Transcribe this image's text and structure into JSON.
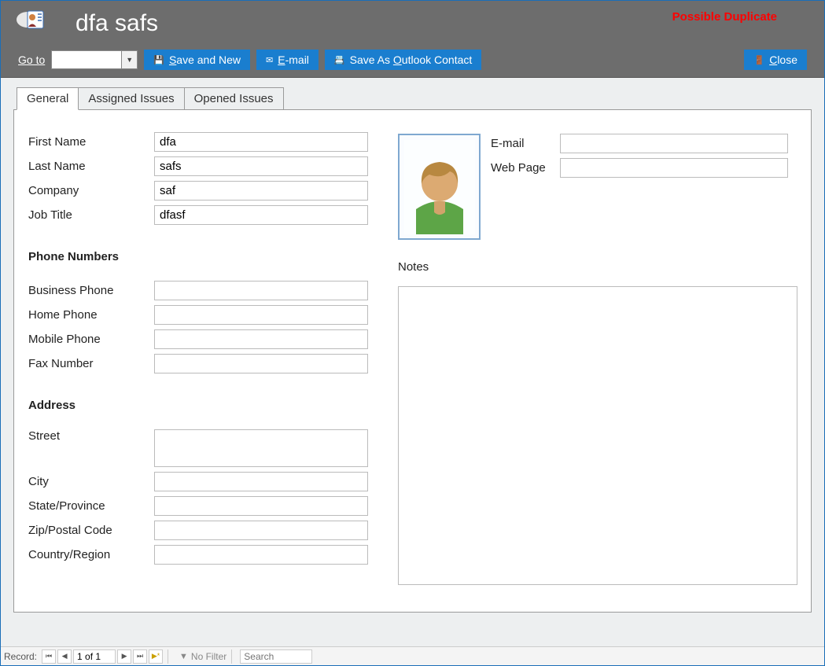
{
  "header": {
    "title": "dfa safs",
    "duplicate_warning": "Possible Duplicate",
    "goto_label": "Go to",
    "buttons": {
      "save_new": "Save and New",
      "email": "E-mail",
      "outlook": "Save As Outlook Contact",
      "close": "Close"
    }
  },
  "tabs": {
    "general": "General",
    "assigned": "Assigned Issues",
    "opened": "Opened Issues"
  },
  "form": {
    "labels": {
      "first_name": "First Name",
      "last_name": "Last Name",
      "company": "Company",
      "job_title": "Job Title",
      "phone_section": "Phone Numbers",
      "business_phone": "Business Phone",
      "home_phone": "Home Phone",
      "mobile_phone": "Mobile Phone",
      "fax": "Fax Number",
      "address_section": "Address",
      "street": "Street",
      "city": "City",
      "state": "State/Province",
      "zip": "Zip/Postal Code",
      "country": "Country/Region",
      "email": "E-mail",
      "web": "Web Page",
      "notes": "Notes"
    },
    "values": {
      "first_name": "dfa",
      "last_name": "safs",
      "company": "saf",
      "job_title": "dfasf",
      "business_phone": "",
      "home_phone": "",
      "mobile_phone": "",
      "fax": "",
      "street": "",
      "city": "",
      "state": "",
      "zip": "",
      "country": "",
      "email": "",
      "web": "",
      "notes": ""
    }
  },
  "statusbar": {
    "record_label": "Record:",
    "record_pos": "1 of 1",
    "no_filter": "No Filter",
    "search_placeholder": "Search"
  }
}
